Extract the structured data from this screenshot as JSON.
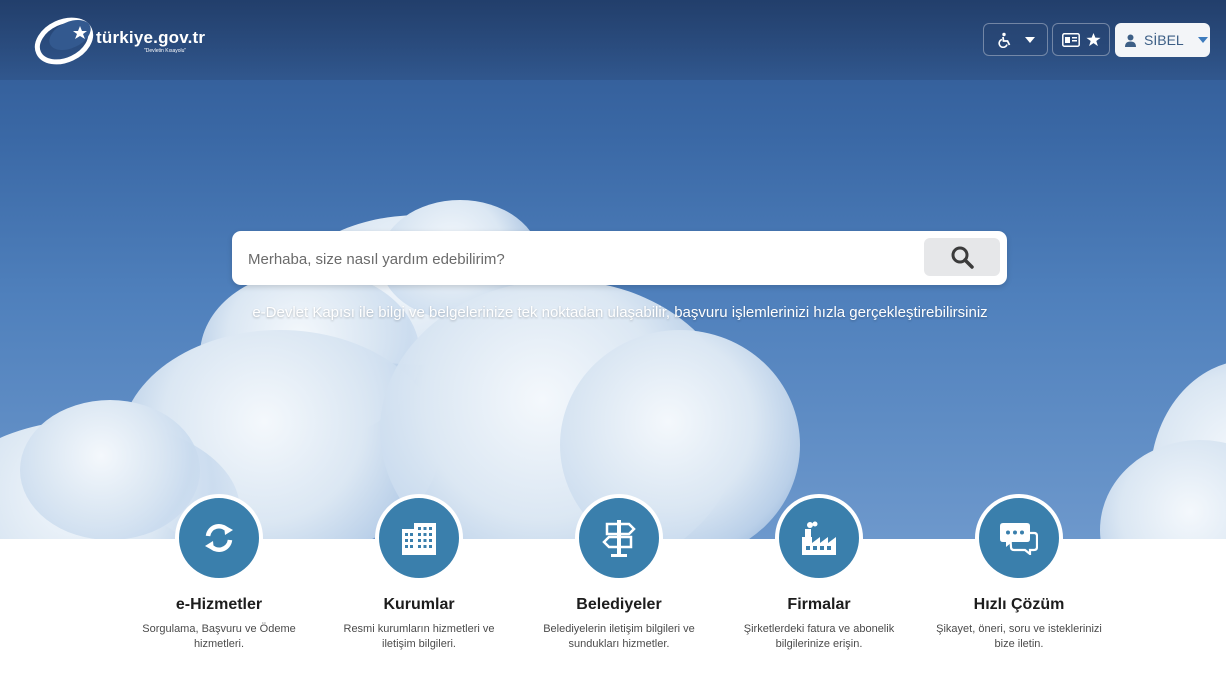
{
  "header": {
    "logo_text": "türkiye.gov.tr",
    "logo_subtext": "\"Devletin Kısayolu\"",
    "user_name": "SİBEL"
  },
  "search": {
    "placeholder": "Merhaba, size nasıl yardım edebilirim?"
  },
  "tagline": "e-Devlet Kapısı ile bilgi ve belgelerinize tek noktadan ulaşabilir, başvuru işlemlerinizi hızla gerçekleştirebilirsiniz",
  "categories": [
    {
      "title": "e-Hizmetler",
      "description": "Sorgulama, Başvuru ve Ödeme hizmetleri.",
      "icon": "refresh-icon"
    },
    {
      "title": "Kurumlar",
      "description": "Resmi kurumların hizmetleri ve iletişim bilgileri.",
      "icon": "building-icon"
    },
    {
      "title": "Belediyeler",
      "description": "Belediyelerin iletişim bilgileri ve sundukları hizmetler.",
      "icon": "signpost-icon"
    },
    {
      "title": "Firmalar",
      "description": "Şirketlerdeki fatura ve abonelik bilgilerinize erişin.",
      "icon": "factory-icon"
    },
    {
      "title": "Hızlı Çözüm",
      "description": "Şikayet, öneri, soru ve isteklerinizi bize iletin.",
      "icon": "chat-icon"
    }
  ],
  "colors": {
    "accent": "#3a7fac",
    "hero_top": "#2f5690",
    "user_button_text": "#3d5f86"
  }
}
